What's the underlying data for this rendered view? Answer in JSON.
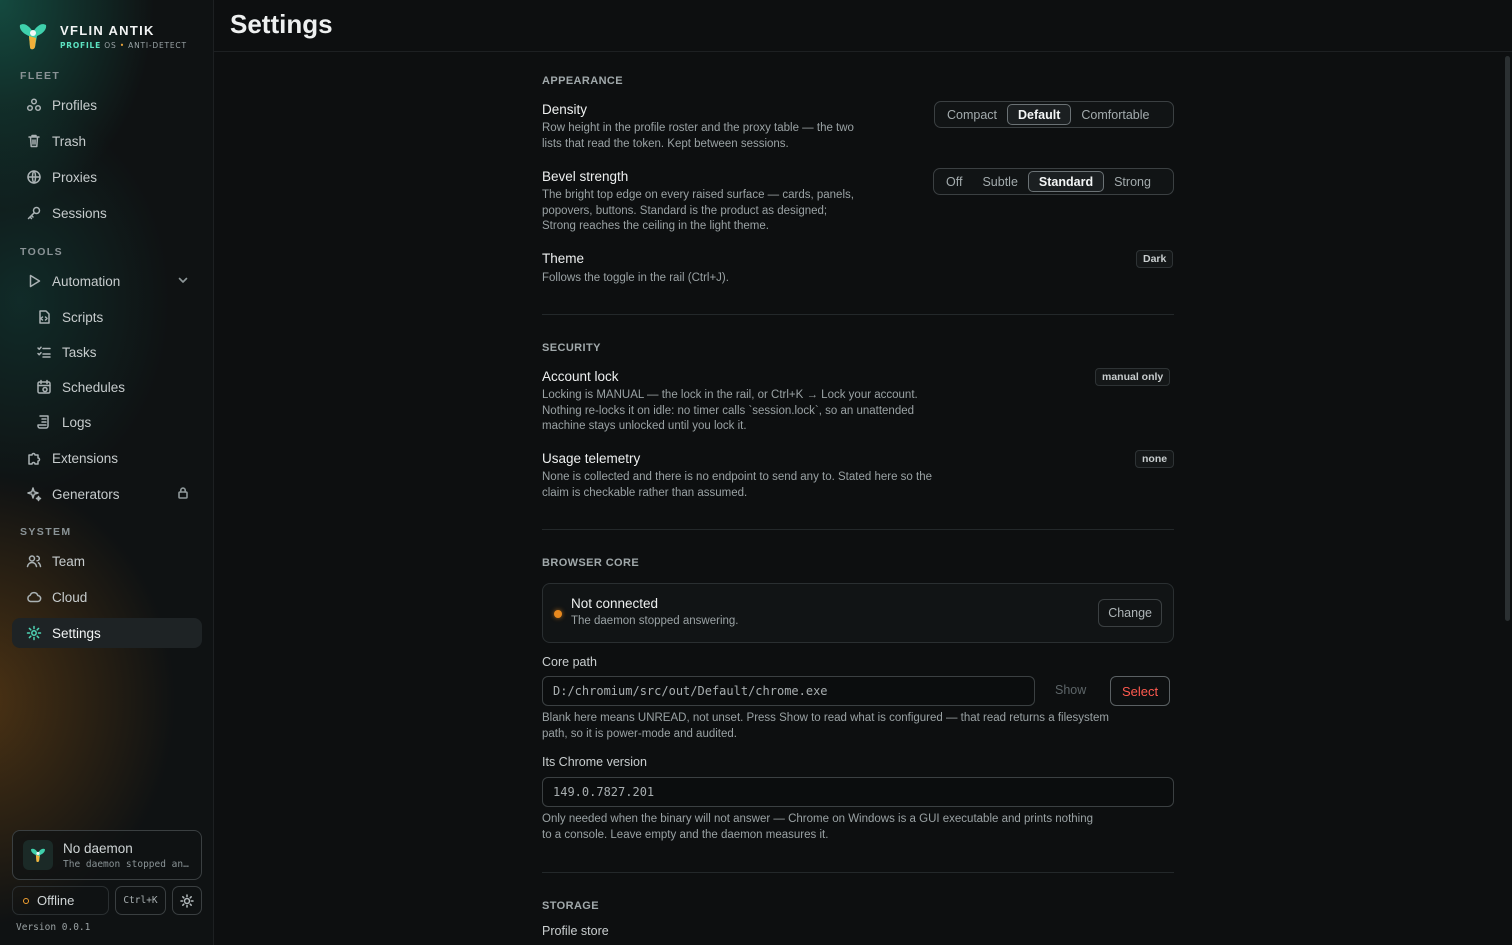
{
  "brand": {
    "name": "VFLIN ANTIK",
    "sub_highlight": "PROFILE",
    "sub_os": "OS",
    "sub_sep": "•",
    "sub_rest": "ANTI-DETECT"
  },
  "sidebar": {
    "sections": {
      "fleet": "FLEET",
      "tools": "TOOLS",
      "system": "SYSTEM"
    },
    "items": {
      "profiles": "Profiles",
      "trash": "Trash",
      "proxies": "Proxies",
      "sessions": "Sessions",
      "automation": "Automation",
      "scripts": "Scripts",
      "tasks": "Tasks",
      "schedules": "Schedules",
      "logs": "Logs",
      "extensions": "Extensions",
      "generators": "Generators",
      "team": "Team",
      "cloud": "Cloud",
      "settings": "Settings"
    },
    "daemon": {
      "title": "No daemon",
      "subtitle": "The daemon stopped answering."
    },
    "status": "Offline",
    "shortcut": "Ctrl+K",
    "version": "Version 0.0.1"
  },
  "page": {
    "title": "Settings"
  },
  "appearance": {
    "heading": "APPEARANCE",
    "density": {
      "title": "Density",
      "desc1": "Row height in the profile roster and the proxy table — the two",
      "desc2": "lists that read the token. Kept between sessions.",
      "options": [
        "Compact",
        "Default",
        "Comfortable"
      ],
      "selected": "Default"
    },
    "bevel": {
      "title": "Bevel strength",
      "desc1": "The bright top edge on every raised surface — cards, panels,",
      "desc2": "popovers, buttons. Standard is the product as designed;",
      "desc3": "Strong reaches the ceiling in the light theme.",
      "options": [
        "Off",
        "Subtle",
        "Standard",
        "Strong"
      ],
      "selected": "Standard"
    },
    "theme": {
      "title": "Theme",
      "desc": "Follows the toggle in the rail (Ctrl+J).",
      "value": "Dark"
    }
  },
  "security": {
    "heading": "SECURITY",
    "account_lock": {
      "title": "Account lock",
      "desc1": "Locking is MANUAL — the lock in the rail, or Ctrl+K → Lock your account.",
      "desc2": "Nothing re-locks it on idle: no timer calls `session.lock`, so an unattended",
      "desc3": "machine stays unlocked until you lock it.",
      "value": "manual only"
    },
    "telemetry": {
      "title": "Usage telemetry",
      "desc1": "None is collected and there is no endpoint to send any to. Stated here so the",
      "desc2": "claim is checkable rather than assumed.",
      "value": "none"
    }
  },
  "browser_core": {
    "heading": "BROWSER CORE",
    "status_title": "Not connected",
    "status_sub": "The daemon stopped answering.",
    "change_label": "Change",
    "core_path": {
      "label": "Core path",
      "value": "D:/chromium/src/out/Default/chrome.exe",
      "show_label": "Show",
      "select_label": "Select",
      "help1": "Blank here means UNREAD, not unset. Press Show to read what is configured — that read returns a filesystem",
      "help2": "path, so it is power-mode and audited."
    },
    "chrome_version": {
      "label": "Its Chrome version",
      "value": "149.0.7827.201",
      "help1": "Only needed when the binary will not answer — Chrome on Windows is a GUI executable and prints nothing",
      "help2": "to a console. Leave empty and the daemon measures it."
    }
  },
  "storage": {
    "heading": "STORAGE",
    "profile_store": "Profile store"
  },
  "colors": {
    "accent": "#4fd6b6",
    "warning": "#e8891e",
    "danger": "#ff5a4f"
  }
}
